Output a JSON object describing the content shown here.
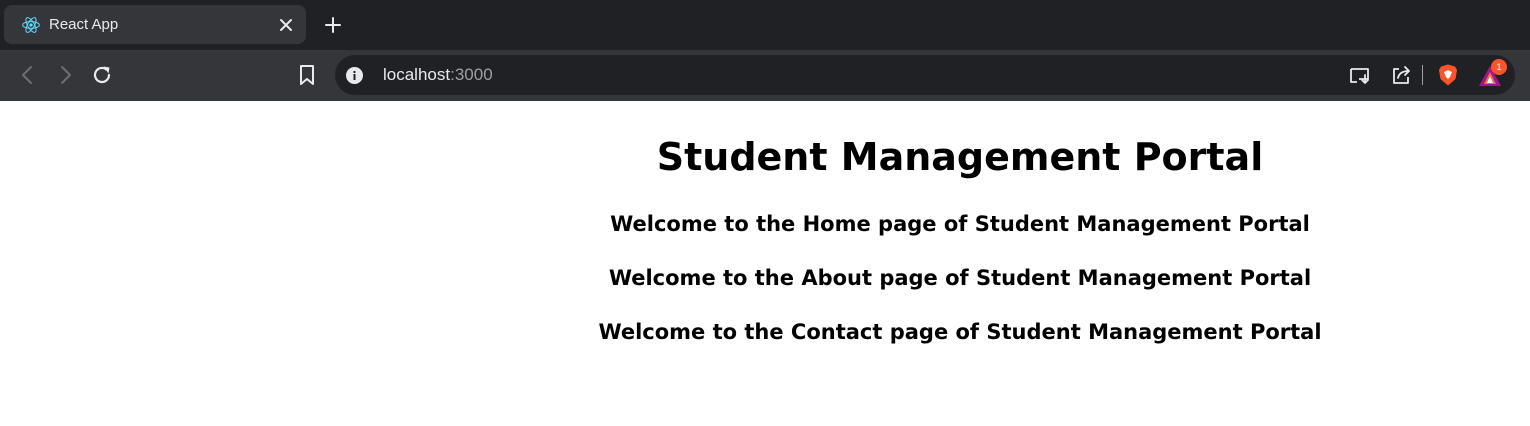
{
  "browser": {
    "tab_title": "React App",
    "url_host": "localhost",
    "url_port": ":3000",
    "notification_count": "1"
  },
  "page": {
    "title": "Student Management Portal",
    "home_text": "Welcome to the Home page of Student Management Portal",
    "about_text": "Welcome to the About page of Student Management Portal",
    "contact_text": "Welcome to the Contact page of Student Management Portal"
  },
  "colors": {
    "tabbar_bg": "#202124",
    "toolbar_bg": "#35363a",
    "react_blue": "#61dafb",
    "brave_orange": "#fb542b"
  }
}
